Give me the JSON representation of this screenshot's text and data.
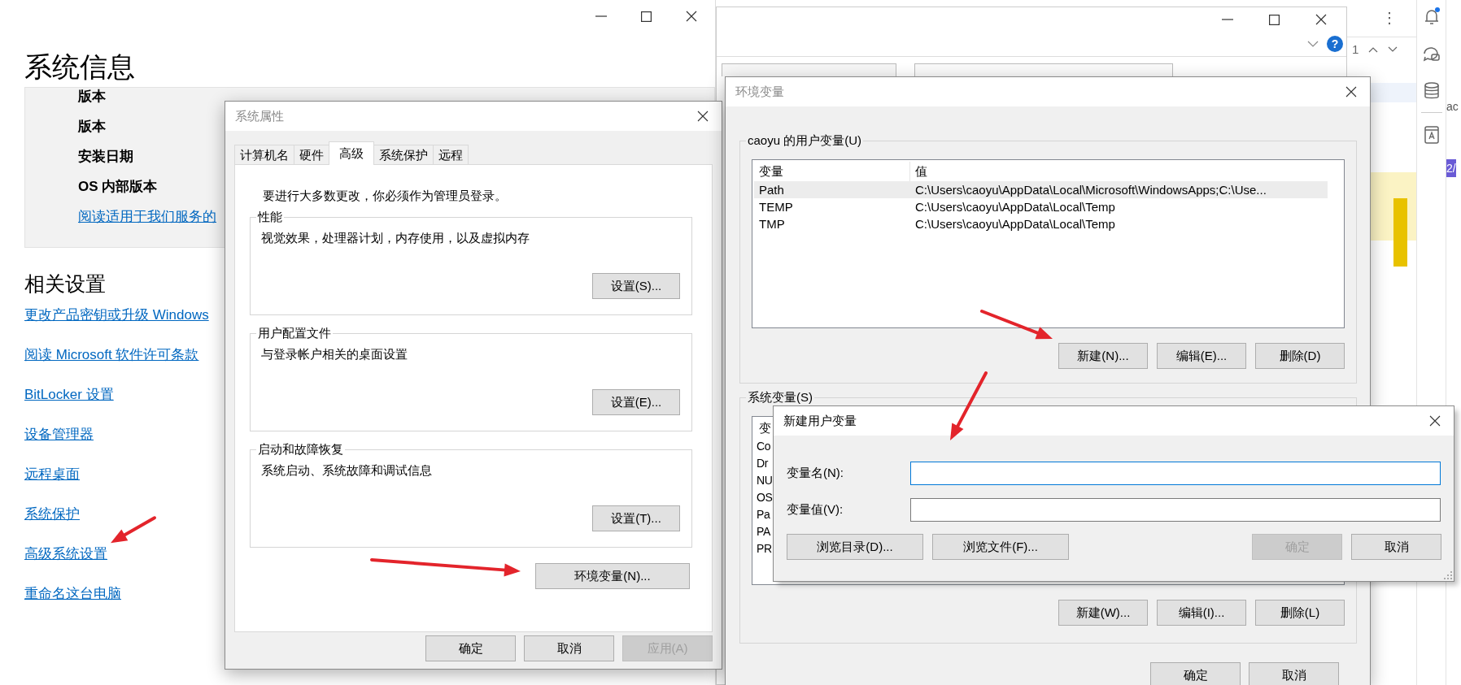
{
  "settings_window": {
    "heading": "系统信息",
    "specs": [
      {
        "kind": "label",
        "text": "版本"
      },
      {
        "kind": "label",
        "text": "版本"
      },
      {
        "kind": "label",
        "text": "安装日期"
      },
      {
        "kind": "label",
        "text": "OS 内部版本"
      },
      {
        "kind": "link",
        "text": "阅读适用于我们服务的"
      }
    ],
    "related_heading": "相关设置",
    "links": [
      {
        "text": "更改产品密钥或升级 Windows",
        "marked": false
      },
      {
        "text": "阅读 Microsoft 软件许可条款",
        "marked": false
      },
      {
        "text": "BitLocker 设置",
        "marked": false
      },
      {
        "text": "设备管理器",
        "marked": false
      },
      {
        "text": "远程桌面",
        "marked": false
      },
      {
        "text": "系统保护",
        "marked": false
      },
      {
        "text": "高级系统设置",
        "marked": true
      },
      {
        "text": "重命名这台电脑",
        "marked": false
      }
    ]
  },
  "background_window": {
    "help": "?"
  },
  "side_app": {
    "more": "⋮",
    "match_count": "1",
    "notification_unread": true,
    "partial_texts": [
      "ac",
      "2/"
    ]
  },
  "system_properties": {
    "title": "系统属性",
    "active": false,
    "tabs": [
      {
        "label": "计算机名",
        "selected": false
      },
      {
        "label": "硬件",
        "selected": false
      },
      {
        "label": "高级",
        "selected": true
      },
      {
        "label": "系统保护",
        "selected": false
      },
      {
        "label": "远程",
        "selected": false
      }
    ],
    "notice": "要进行大多数更改，你必须作为管理员登录。",
    "groups": [
      {
        "title": "性能",
        "description": "视觉效果，处理器计划，内存使用，以及虚拟内存",
        "button": "设置(S)..."
      },
      {
        "title": "用户配置文件",
        "description": "与登录帐户相关的桌面设置",
        "button": "设置(E)..."
      },
      {
        "title": "启动和故障恢复",
        "description": "系统启动、系统故障和调试信息",
        "button": "设置(T)..."
      }
    ],
    "env_button": {
      "label": "环境变量(N)...",
      "marked": true
    },
    "buttons": [
      {
        "label": "确定",
        "disabled": false
      },
      {
        "label": "取消",
        "disabled": false
      },
      {
        "label": "应用(A)",
        "disabled": true
      }
    ]
  },
  "environment_variables": {
    "title": "环境变量",
    "active": false,
    "user_group": {
      "title": "caoyu 的用户变量(U)",
      "columns": [
        "变量",
        "值"
      ],
      "rows": [
        {
          "name": "Path",
          "value": "C:\\Users\\caoyu\\AppData\\Local\\Microsoft\\WindowsApps;C:\\Use...",
          "selected": true
        },
        {
          "name": "TEMP",
          "value": "C:\\Users\\caoyu\\AppData\\Local\\Temp",
          "selected": false
        },
        {
          "name": "TMP",
          "value": "C:\\Users\\caoyu\\AppData\\Local\\Temp",
          "selected": false
        }
      ],
      "buttons": [
        {
          "label": "新建(N)...",
          "marked": true
        },
        {
          "label": "编辑(E)...",
          "marked": false
        },
        {
          "label": "删除(D)",
          "marked": false
        }
      ]
    },
    "system_group": {
      "title": "系统变量(S)",
      "columns": [
        "变"
      ],
      "rows": [
        {
          "name": "Co"
        },
        {
          "name": "Dr"
        },
        {
          "name": "NU"
        },
        {
          "name": "OS"
        },
        {
          "name": "Pa"
        },
        {
          "name": "PA"
        },
        {
          "name": "PR"
        }
      ],
      "buttons": [
        {
          "label": "新建(W)...",
          "marked": false
        },
        {
          "label": "编辑(I)...",
          "marked": false
        },
        {
          "label": "删除(L)",
          "marked": false
        }
      ]
    },
    "buttons": [
      {
        "label": "确定",
        "disabled": false
      },
      {
        "label": "取消",
        "disabled": false
      }
    ]
  },
  "new_variable_dialog": {
    "title": "新建用户变量",
    "active": true,
    "marked": true,
    "fields": [
      {
        "label": "变量名(N):",
        "focused": true
      },
      {
        "label": "变量值(V):",
        "focused": false
      }
    ],
    "buttons": [
      {
        "label": "浏览目录(D)...",
        "disabled": false
      },
      {
        "label": "浏览文件(F)...",
        "disabled": false
      },
      {
        "label": "确定",
        "disabled": true
      },
      {
        "label": "取消",
        "disabled": false
      }
    ]
  }
}
